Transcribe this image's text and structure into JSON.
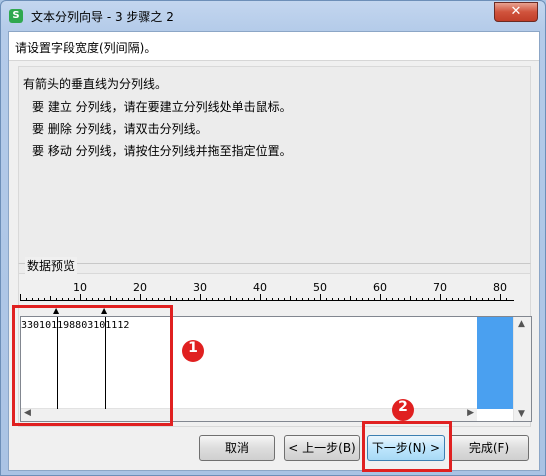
{
  "window": {
    "title": "文本分列向导 - 3 步骤之 2",
    "app_icon_letter": "S",
    "close_label": "✕"
  },
  "header": {
    "subtitle": "请设置字段宽度(列间隔)。"
  },
  "instructions": {
    "lines": [
      "有箭头的垂直线为分列线。",
      "要 建立 分列线，请在要建立分列线处单击鼠标。",
      "要 删除 分列线，请双击分列线。",
      "要 移动 分列线，请按住分列线并拖至指定位置。"
    ]
  },
  "preview": {
    "label": "数据预览",
    "ruler_labels": [
      "10",
      "20",
      "30",
      "40",
      "50",
      "60",
      "70",
      "80"
    ],
    "row": "330101198803101112",
    "column_breaks": [
      6,
      14
    ]
  },
  "buttons": {
    "cancel": "取消",
    "back": "< 上一步(B)",
    "next": "下一步(N) >",
    "finish": "完成(F)"
  },
  "annotations": {
    "one": "1",
    "two": "2"
  }
}
